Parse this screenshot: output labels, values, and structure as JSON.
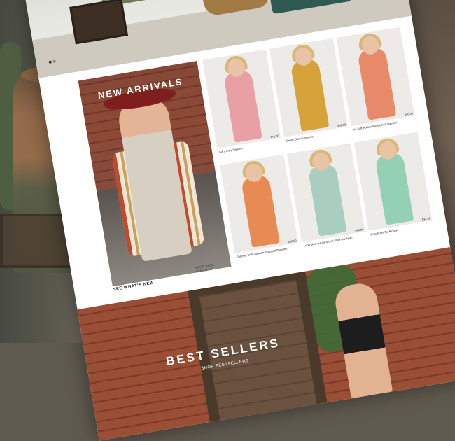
{
  "new_arrivals": {
    "title": "NEW ARRIVALS",
    "shop_label": "SHOP NEW ARRIVALS",
    "see_label": "SEE WHAT'S NEW"
  },
  "products": [
    {
      "name": "Cara Ivory Sweater",
      "price": "$42.00",
      "color": "#e8a0a4"
    },
    {
      "name": "Denim Sleeve Sweater",
      "price": "$42.00",
      "color": "#d6a33a"
    },
    {
      "name": "Ny Soft Pocket Sleeve Knit Sweater",
      "price": "$40.00",
      "color": "#e8896a"
    },
    {
      "name": "Pullover Multi Sweater Dropped Shoulder",
      "price": "$42.00",
      "color": "#e88a54"
    },
    {
      "name": "Long Sleeve Knit Jacket Style Cardigan",
      "price": "$48.00",
      "color": "#a9cdbf"
    },
    {
      "name": "Dory Front Tie Blouse",
      "price": "$34.00",
      "color": "#93d0b4"
    }
  ],
  "best_sellers": {
    "title": "BEST SELLERS",
    "shop_label": "SHOP BESTSELLERS"
  }
}
